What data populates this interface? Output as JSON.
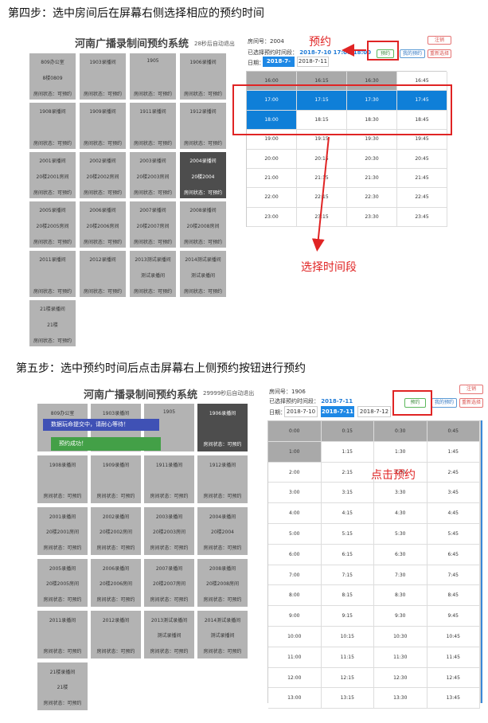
{
  "step4": {
    "heading": "第四步：选中房间后在屏幕右侧选择相应的预约时间",
    "system_title": "河南广播录制间预约系统",
    "auto_exit": "28秒后自动退出",
    "rooms": [
      {
        "line1": "809办公室",
        "line2": "8楼0809",
        "status": "房间状态：可预约",
        "dark": false
      },
      {
        "line1": "1903录播间",
        "line2": "",
        "status": "房间状态：可预约",
        "dark": false
      },
      {
        "line1": "1905",
        "line2": "",
        "status": "房间状态：可预约",
        "dark": false
      },
      {
        "line1": "1906录播间",
        "line2": "",
        "status": "房间状态：可预约",
        "dark": false
      },
      {
        "line1": "1908录播间",
        "line2": "",
        "status": "房间状态：可预约",
        "dark": false
      },
      {
        "line1": "1909录播间",
        "line2": "",
        "status": "房间状态：可预约",
        "dark": false
      },
      {
        "line1": "1911录播间",
        "line2": "",
        "status": "房间状态：可预约",
        "dark": false
      },
      {
        "line1": "1912录播间",
        "line2": "",
        "status": "房间状态：可预约",
        "dark": false
      },
      {
        "line1": "2001录播间",
        "line2": "20楼2001房间",
        "status": "房间状态：可预约",
        "dark": false
      },
      {
        "line1": "2002录播间",
        "line2": "20楼2002房间",
        "status": "房间状态：可预约",
        "dark": false
      },
      {
        "line1": "2003录播间",
        "line2": "20楼2003房间",
        "status": "房间状态：可预约",
        "dark": false
      },
      {
        "line1": "2004录播间",
        "line2": "20楼2004",
        "status": "房间状态：可预约",
        "dark": true
      },
      {
        "line1": "2005录播间",
        "line2": "20楼2005房间",
        "status": "房间状态：可预约",
        "dark": false
      },
      {
        "line1": "2006录播间",
        "line2": "20楼2006房间",
        "status": "房间状态：可预约",
        "dark": false
      },
      {
        "line1": "2007录播间",
        "line2": "20楼2007房间",
        "status": "房间状态：可预约",
        "dark": false
      },
      {
        "line1": "2008录播间",
        "line2": "20楼2008房间",
        "status": "房间状态：可预约",
        "dark": false
      },
      {
        "line1": "2011录播间",
        "line2": "",
        "status": "房间状态：可预约",
        "dark": false
      },
      {
        "line1": "2012录播间",
        "line2": "",
        "status": "房间状态：可预约",
        "dark": false
      },
      {
        "line1": "2013测试录播间",
        "line2": "测试录播间",
        "status": "房间状态：可预约",
        "dark": false
      },
      {
        "line1": "2014测试录播间",
        "line2": "测试录播间",
        "status": "房间状态：可预约",
        "dark": false
      },
      {
        "line1": "21楼录播间",
        "line2": "21楼",
        "status": "房间状态：可预约",
        "dark": false
      }
    ],
    "room_no_label": "房间号：2004",
    "selected_label": "已选择预约时间段：",
    "selected_value": "2018-7-10 17:00-18:00",
    "date_label": "日期：",
    "dates": [
      "2018-7-10",
      "2018-7-11"
    ],
    "btn_book": "预约",
    "btn_mine": "我的预约",
    "btn_logout": "注销",
    "btn_reselect": "重新选择",
    "callout_book": "预约",
    "callout_select": "选择时间段",
    "slots": [
      [
        "16:00",
        "gray"
      ],
      [
        "16:15",
        "gray"
      ],
      [
        "16:30",
        "gray"
      ],
      [
        "16:45",
        ""
      ],
      [
        "17:00",
        "sel"
      ],
      [
        "17:15",
        "sel"
      ],
      [
        "17:30",
        "sel"
      ],
      [
        "17:45",
        "sel"
      ],
      [
        "18:00",
        "sel"
      ],
      [
        "18:15",
        ""
      ],
      [
        "18:30",
        ""
      ],
      [
        "18:45",
        ""
      ],
      [
        "19:00",
        ""
      ],
      [
        "19:15",
        ""
      ],
      [
        "19:30",
        ""
      ],
      [
        "19:45",
        ""
      ],
      [
        "20:00",
        ""
      ],
      [
        "20:15",
        ""
      ],
      [
        "20:30",
        ""
      ],
      [
        "20:45",
        ""
      ],
      [
        "21:00",
        ""
      ],
      [
        "21:15",
        ""
      ],
      [
        "21:30",
        ""
      ],
      [
        "21:45",
        ""
      ],
      [
        "22:00",
        ""
      ],
      [
        "22:15",
        ""
      ],
      [
        "22:30",
        ""
      ],
      [
        "22:45",
        ""
      ],
      [
        "23:00",
        ""
      ],
      [
        "23:15",
        ""
      ],
      [
        "23:30",
        ""
      ],
      [
        "23:45",
        ""
      ]
    ]
  },
  "step5": {
    "heading": "第五步：选中预约时间后点击屏幕右上侧预约按钮进行预约",
    "system_title": "河南广播录制间预约系统",
    "auto_exit": "29999秒后自动退出",
    "toast_submitting": "数据玩命提交中，请耐心等待！",
    "toast_success": "预约成功！",
    "rooms": [
      {
        "line1": "809办公室",
        "line2": "",
        "status": "",
        "dark": false
      },
      {
        "line1": "1903录播间",
        "line2": "",
        "status": "",
        "dark": false
      },
      {
        "line1": "1905",
        "line2": "",
        "status": "",
        "dark": false
      },
      {
        "line1": "1906录播间",
        "line2": "",
        "status": "房间状态：可预约",
        "dark": true
      },
      {
        "line1": "1908录播间",
        "line2": "",
        "status": "房间状态：可预约",
        "dark": false
      },
      {
        "line1": "1909录播间",
        "line2": "",
        "status": "房间状态：可预约",
        "dark": false
      },
      {
        "line1": "1911录播间",
        "line2": "",
        "status": "房间状态：可预约",
        "dark": false
      },
      {
        "line1": "1912录播间",
        "line2": "",
        "status": "房间状态：可预约",
        "dark": false
      },
      {
        "line1": "2001录播间",
        "line2": "20楼2001房间",
        "status": "房间状态：可预约",
        "dark": false
      },
      {
        "line1": "2002录播间",
        "line2": "20楼2002房间",
        "status": "房间状态：可预约",
        "dark": false
      },
      {
        "line1": "2003录播间",
        "line2": "20楼2003房间",
        "status": "房间状态：可预约",
        "dark": false
      },
      {
        "line1": "2004录播间",
        "line2": "20楼2004",
        "status": "房间状态：可预约",
        "dark": false
      },
      {
        "line1": "2005录播间",
        "line2": "20楼2005房间",
        "status": "房间状态：可预约",
        "dark": false
      },
      {
        "line1": "2006录播间",
        "line2": "20楼2006房间",
        "status": "房间状态：可预约",
        "dark": false
      },
      {
        "line1": "2007录播间",
        "line2": "20楼2007房间",
        "status": "房间状态：可预约",
        "dark": false
      },
      {
        "line1": "2008录播间",
        "line2": "20楼2008房间",
        "status": "房间状态：可预约",
        "dark": false
      },
      {
        "line1": "2011录播间",
        "line2": "",
        "status": "房间状态：可预约",
        "dark": false
      },
      {
        "line1": "2012录播间",
        "line2": "",
        "status": "房间状态：可预约",
        "dark": false
      },
      {
        "line1": "2013测试录播间",
        "line2": "测试录播间",
        "status": "房间状态：可预约",
        "dark": false
      },
      {
        "line1": "2014测试录播间",
        "line2": "测试录播间",
        "status": "房间状态：可预约",
        "dark": false
      },
      {
        "line1": "21楼录播间",
        "line2": "21楼",
        "status": "房间状态：可预约",
        "dark": false
      }
    ],
    "room_no_label": "房间号：1906",
    "selected_label": "已选择预约时间段：",
    "selected_value": "2018-7-11",
    "date_label": "日期：",
    "dates": [
      "2018-7-10",
      "2018-7-11",
      "2018-7-12"
    ],
    "btn_book": "预约",
    "btn_mine": "我的预约",
    "btn_logout": "注销",
    "btn_reselect": "重新选择",
    "callout_book": "点击预约",
    "slots": [
      [
        "0:00",
        "gray"
      ],
      [
        "0:15",
        "gray"
      ],
      [
        "0:30",
        "gray"
      ],
      [
        "0:45",
        "gray"
      ],
      [
        "1:00",
        "gray"
      ],
      [
        "1:15",
        ""
      ],
      [
        "1:30",
        ""
      ],
      [
        "1:45",
        ""
      ],
      [
        "2:00",
        ""
      ],
      [
        "2:15",
        ""
      ],
      [
        "2:30",
        ""
      ],
      [
        "2:45",
        ""
      ],
      [
        "3:00",
        ""
      ],
      [
        "3:15",
        ""
      ],
      [
        "3:30",
        ""
      ],
      [
        "3:45",
        ""
      ],
      [
        "4:00",
        ""
      ],
      [
        "4:15",
        ""
      ],
      [
        "4:30",
        ""
      ],
      [
        "4:45",
        ""
      ],
      [
        "5:00",
        ""
      ],
      [
        "5:15",
        ""
      ],
      [
        "5:30",
        ""
      ],
      [
        "5:45",
        ""
      ],
      [
        "6:00",
        ""
      ],
      [
        "6:15",
        ""
      ],
      [
        "6:30",
        ""
      ],
      [
        "6:45",
        ""
      ],
      [
        "7:00",
        ""
      ],
      [
        "7:15",
        ""
      ],
      [
        "7:30",
        ""
      ],
      [
        "7:45",
        ""
      ],
      [
        "8:00",
        ""
      ],
      [
        "8:15",
        ""
      ],
      [
        "8:30",
        ""
      ],
      [
        "8:45",
        ""
      ],
      [
        "9:00",
        ""
      ],
      [
        "9:15",
        ""
      ],
      [
        "9:30",
        ""
      ],
      [
        "9:45",
        ""
      ],
      [
        "10:00",
        ""
      ],
      [
        "10:15",
        ""
      ],
      [
        "10:30",
        ""
      ],
      [
        "10:45",
        ""
      ],
      [
        "11:00",
        ""
      ],
      [
        "11:15",
        ""
      ],
      [
        "11:30",
        ""
      ],
      [
        "11:45",
        ""
      ],
      [
        "12:00",
        ""
      ],
      [
        "12:15",
        ""
      ],
      [
        "12:30",
        ""
      ],
      [
        "12:45",
        ""
      ],
      [
        "13:00",
        ""
      ],
      [
        "13:15",
        ""
      ],
      [
        "13:30",
        ""
      ],
      [
        "13:45",
        ""
      ]
    ]
  }
}
